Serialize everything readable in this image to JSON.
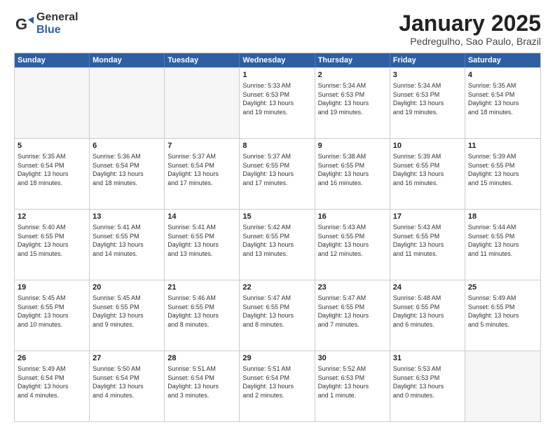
{
  "logo": {
    "general": "General",
    "blue": "Blue"
  },
  "title": "January 2025",
  "subtitle": "Pedregulho, Sao Paulo, Brazil",
  "header_days": [
    "Sunday",
    "Monday",
    "Tuesday",
    "Wednesday",
    "Thursday",
    "Friday",
    "Saturday"
  ],
  "weeks": [
    [
      {
        "day": "",
        "info": ""
      },
      {
        "day": "",
        "info": ""
      },
      {
        "day": "",
        "info": ""
      },
      {
        "day": "1",
        "info": "Sunrise: 5:33 AM\nSunset: 6:53 PM\nDaylight: 13 hours\nand 19 minutes."
      },
      {
        "day": "2",
        "info": "Sunrise: 5:34 AM\nSunset: 6:53 PM\nDaylight: 13 hours\nand 19 minutes."
      },
      {
        "day": "3",
        "info": "Sunrise: 5:34 AM\nSunset: 6:53 PM\nDaylight: 13 hours\nand 19 minutes."
      },
      {
        "day": "4",
        "info": "Sunrise: 5:35 AM\nSunset: 6:54 PM\nDaylight: 13 hours\nand 18 minutes."
      }
    ],
    [
      {
        "day": "5",
        "info": "Sunrise: 5:35 AM\nSunset: 6:54 PM\nDaylight: 13 hours\nand 18 minutes."
      },
      {
        "day": "6",
        "info": "Sunrise: 5:36 AM\nSunset: 6:54 PM\nDaylight: 13 hours\nand 18 minutes."
      },
      {
        "day": "7",
        "info": "Sunrise: 5:37 AM\nSunset: 6:54 PM\nDaylight: 13 hours\nand 17 minutes."
      },
      {
        "day": "8",
        "info": "Sunrise: 5:37 AM\nSunset: 6:55 PM\nDaylight: 13 hours\nand 17 minutes."
      },
      {
        "day": "9",
        "info": "Sunrise: 5:38 AM\nSunset: 6:55 PM\nDaylight: 13 hours\nand 16 minutes."
      },
      {
        "day": "10",
        "info": "Sunrise: 5:39 AM\nSunset: 6:55 PM\nDaylight: 13 hours\nand 16 minutes."
      },
      {
        "day": "11",
        "info": "Sunrise: 5:39 AM\nSunset: 6:55 PM\nDaylight: 13 hours\nand 15 minutes."
      }
    ],
    [
      {
        "day": "12",
        "info": "Sunrise: 5:40 AM\nSunset: 6:55 PM\nDaylight: 13 hours\nand 15 minutes."
      },
      {
        "day": "13",
        "info": "Sunrise: 5:41 AM\nSunset: 6:55 PM\nDaylight: 13 hours\nand 14 minutes."
      },
      {
        "day": "14",
        "info": "Sunrise: 5:41 AM\nSunset: 6:55 PM\nDaylight: 13 hours\nand 13 minutes."
      },
      {
        "day": "15",
        "info": "Sunrise: 5:42 AM\nSunset: 6:55 PM\nDaylight: 13 hours\nand 13 minutes."
      },
      {
        "day": "16",
        "info": "Sunrise: 5:43 AM\nSunset: 6:55 PM\nDaylight: 13 hours\nand 12 minutes."
      },
      {
        "day": "17",
        "info": "Sunrise: 5:43 AM\nSunset: 6:55 PM\nDaylight: 13 hours\nand 11 minutes."
      },
      {
        "day": "18",
        "info": "Sunrise: 5:44 AM\nSunset: 6:55 PM\nDaylight: 13 hours\nand 11 minutes."
      }
    ],
    [
      {
        "day": "19",
        "info": "Sunrise: 5:45 AM\nSunset: 6:55 PM\nDaylight: 13 hours\nand 10 minutes."
      },
      {
        "day": "20",
        "info": "Sunrise: 5:45 AM\nSunset: 6:55 PM\nDaylight: 13 hours\nand 9 minutes."
      },
      {
        "day": "21",
        "info": "Sunrise: 5:46 AM\nSunset: 6:55 PM\nDaylight: 13 hours\nand 8 minutes."
      },
      {
        "day": "22",
        "info": "Sunrise: 5:47 AM\nSunset: 6:55 PM\nDaylight: 13 hours\nand 8 minutes."
      },
      {
        "day": "23",
        "info": "Sunrise: 5:47 AM\nSunset: 6:55 PM\nDaylight: 13 hours\nand 7 minutes."
      },
      {
        "day": "24",
        "info": "Sunrise: 5:48 AM\nSunset: 6:55 PM\nDaylight: 13 hours\nand 6 minutes."
      },
      {
        "day": "25",
        "info": "Sunrise: 5:49 AM\nSunset: 6:55 PM\nDaylight: 13 hours\nand 5 minutes."
      }
    ],
    [
      {
        "day": "26",
        "info": "Sunrise: 5:49 AM\nSunset: 6:54 PM\nDaylight: 13 hours\nand 4 minutes."
      },
      {
        "day": "27",
        "info": "Sunrise: 5:50 AM\nSunset: 6:54 PM\nDaylight: 13 hours\nand 4 minutes."
      },
      {
        "day": "28",
        "info": "Sunrise: 5:51 AM\nSunset: 6:54 PM\nDaylight: 13 hours\nand 3 minutes."
      },
      {
        "day": "29",
        "info": "Sunrise: 5:51 AM\nSunset: 6:54 PM\nDaylight: 13 hours\nand 2 minutes."
      },
      {
        "day": "30",
        "info": "Sunrise: 5:52 AM\nSunset: 6:53 PM\nDaylight: 13 hours\nand 1 minute."
      },
      {
        "day": "31",
        "info": "Sunrise: 5:53 AM\nSunset: 6:53 PM\nDaylight: 13 hours\nand 0 minutes."
      },
      {
        "day": "",
        "info": ""
      }
    ]
  ]
}
